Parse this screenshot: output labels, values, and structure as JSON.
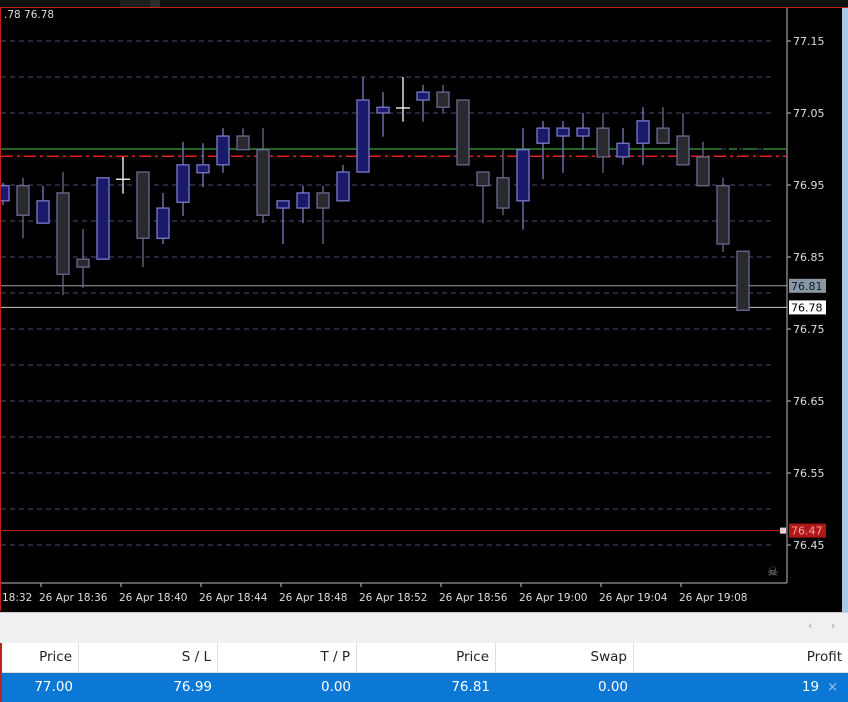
{
  "chart": {
    "label": ".78 76.78",
    "colors": {
      "bull_fill": "#1a1a6a",
      "bull_stroke": "#7a7ac8",
      "bear_fill": "#2a2a2e",
      "bear_stroke": "#6a6a90",
      "doji": "#ffffff",
      "grid": "#4a4a78",
      "entry_line": "#3ca03c",
      "sl_line": "#e02020",
      "bid_line": "#9aa0a8",
      "ask_line": "#c8c8c8",
      "alert_line": "#d02020"
    },
    "price_axis": {
      "labels": [
        "77.15",
        "77.05",
        "76.95",
        "76.85",
        "76.75",
        "76.65",
        "76.55",
        "76.45"
      ],
      "min": 76.43,
      "max": 77.2
    },
    "grid_prices": [
      77.15,
      77.1,
      77.05,
      77.0,
      76.95,
      76.9,
      76.85,
      76.8,
      76.75,
      76.7,
      76.65,
      76.6,
      76.55,
      76.5,
      76.45
    ],
    "time_axis": [
      "18:32",
      "26 Apr 18:36",
      "26 Apr 18:40",
      "26 Apr 18:44",
      "26 Apr 18:48",
      "26 Apr 18:52",
      "26 Apr 18:56",
      "26 Apr 19:00",
      "26 Apr 19:04",
      "26 Apr 19:08"
    ],
    "lines": {
      "entry": 77.0,
      "stop_loss": 76.99,
      "bid": {
        "price": 76.81,
        "label": "76.81"
      },
      "ask": {
        "price": 76.78,
        "label": "76.78"
      },
      "alert": {
        "price": 76.47,
        "label": "76.47"
      }
    },
    "candles_columns": [
      "time",
      "open",
      "high",
      "low",
      "close"
    ],
    "candles": [
      [
        "18:34",
        76.928,
        76.953,
        76.922,
        76.949
      ],
      [
        "18:35",
        76.949,
        76.96,
        76.876,
        76.908
      ],
      [
        "18:36",
        76.897,
        76.949,
        76.897,
        76.928
      ],
      [
        "18:37",
        76.939,
        76.968,
        76.797,
        76.826
      ],
      [
        "18:38",
        76.847,
        76.889,
        76.807,
        76.836
      ],
      [
        "18:39",
        76.847,
        76.96,
        76.847,
        76.96
      ],
      [
        "18:40",
        76.958,
        76.989,
        76.938,
        76.958
      ],
      [
        "18:41",
        76.968,
        76.968,
        76.836,
        76.876
      ],
      [
        "18:42",
        76.876,
        76.939,
        76.868,
        76.918
      ],
      [
        "18:43",
        76.926,
        77.01,
        76.907,
        76.978
      ],
      [
        "18:44",
        76.967,
        77.008,
        76.947,
        76.978
      ],
      [
        "18:45",
        76.978,
        77.029,
        76.967,
        77.018
      ],
      [
        "18:46",
        77.018,
        77.029,
        76.999,
        76.999
      ],
      [
        "18:47",
        76.999,
        77.029,
        76.897,
        76.908
      ],
      [
        "18:48",
        76.918,
        76.928,
        76.868,
        76.928
      ],
      [
        "18:49",
        76.918,
        76.949,
        76.897,
        76.939
      ],
      [
        "18:50",
        76.939,
        76.949,
        76.868,
        76.918
      ],
      [
        "18:51",
        76.928,
        76.978,
        76.928,
        76.968
      ],
      [
        "18:52",
        76.968,
        77.1,
        76.968,
        77.068
      ],
      [
        "18:53",
        77.05,
        77.079,
        77.017,
        77.058
      ],
      [
        "18:54",
        77.057,
        77.1,
        77.038,
        77.057
      ],
      [
        "18:55",
        77.068,
        77.089,
        77.038,
        77.079
      ],
      [
        "18:56",
        77.079,
        77.089,
        77.05,
        77.058
      ],
      [
        "18:57",
        77.068,
        77.068,
        76.978,
        76.978
      ],
      [
        "18:58",
        76.968,
        76.968,
        76.897,
        76.949
      ],
      [
        "18:59",
        76.96,
        76.999,
        76.908,
        76.918
      ],
      [
        "19:00",
        76.928,
        77.029,
        76.888,
        76.999
      ],
      [
        "19:01",
        77.008,
        77.039,
        76.958,
        77.029
      ],
      [
        "19:02",
        77.018,
        77.039,
        76.967,
        77.029
      ],
      [
        "19:03",
        77.018,
        77.05,
        76.999,
        77.029
      ],
      [
        "19:04",
        77.029,
        77.05,
        76.967,
        76.989
      ],
      [
        "19:05",
        76.989,
        77.029,
        76.978,
        77.008
      ],
      [
        "19:06",
        77.008,
        77.058,
        76.978,
        77.039
      ],
      [
        "19:07",
        77.029,
        77.058,
        77.008,
        77.008
      ],
      [
        "19:08",
        77.018,
        77.05,
        76.978,
        76.978
      ],
      [
        "19:09",
        76.989,
        77.01,
        76.949,
        76.949
      ],
      [
        "19:10",
        76.949,
        76.96,
        76.857,
        76.868
      ],
      [
        "19:11",
        76.858,
        76.858,
        76.776,
        76.776
      ]
    ]
  },
  "toolbar": {
    "scroll_left": "‹",
    "scroll_right": "›"
  },
  "table": {
    "headers": [
      "Price",
      "S / L",
      "T / P",
      "Price",
      "Swap",
      "Profit"
    ],
    "row": [
      "77.00",
      "76.99",
      "0.00",
      "76.81",
      "0.00",
      "19"
    ],
    "close_icon": "×"
  }
}
